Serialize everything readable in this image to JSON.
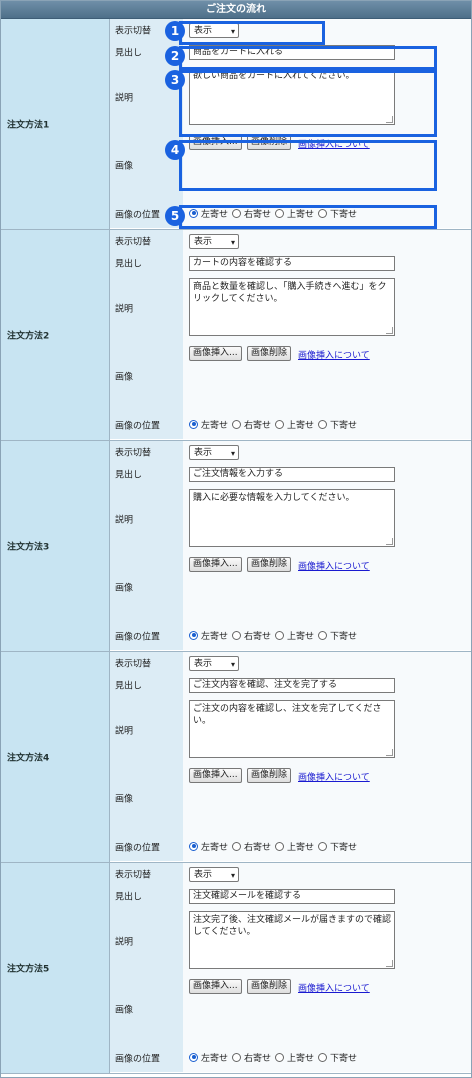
{
  "header": {
    "title": "ご注文の流れ"
  },
  "labels": {
    "display": "表示切替",
    "heading": "見出し",
    "description": "説明",
    "image": "画像",
    "position": "画像の位置"
  },
  "controls": {
    "display_value": "表示",
    "insert_button": "画像挿入...",
    "delete_button": "画像削除",
    "about_link": "画像挿入について",
    "positions": [
      "左寄せ",
      "右寄せ",
      "上寄せ",
      "下寄せ"
    ]
  },
  "sections": [
    {
      "label": "注文方法1",
      "heading": "商品をカートに入れる",
      "description": "欲しい商品をカートに入れてください。",
      "selected_position": "左寄せ"
    },
    {
      "label": "注文方法2",
      "heading": "カートの内容を確認する",
      "description": "商品と数量を確認し、「購入手続きへ進む」をクリックしてください。",
      "selected_position": "左寄せ"
    },
    {
      "label": "注文方法3",
      "heading": "ご注文情報を入力する",
      "description": "購入に必要な情報を入力してください。",
      "selected_position": "左寄せ"
    },
    {
      "label": "注文方法4",
      "heading": "ご注文内容を確認、注文を完了する",
      "description": "ご注文の内容を確認し、注文を完了してください。",
      "selected_position": "左寄せ"
    },
    {
      "label": "注文方法5",
      "heading": "注文確認メールを確認する",
      "description": "注文完了後、注文確認メールが届きますので確認してください。",
      "selected_position": "左寄せ"
    }
  ],
  "callouts": [
    "1",
    "2",
    "3",
    "4",
    "5"
  ],
  "colors": {
    "accent": "#1a62e0",
    "label_bg": "#c8e4f2",
    "header_bg": "#5b7d97"
  }
}
